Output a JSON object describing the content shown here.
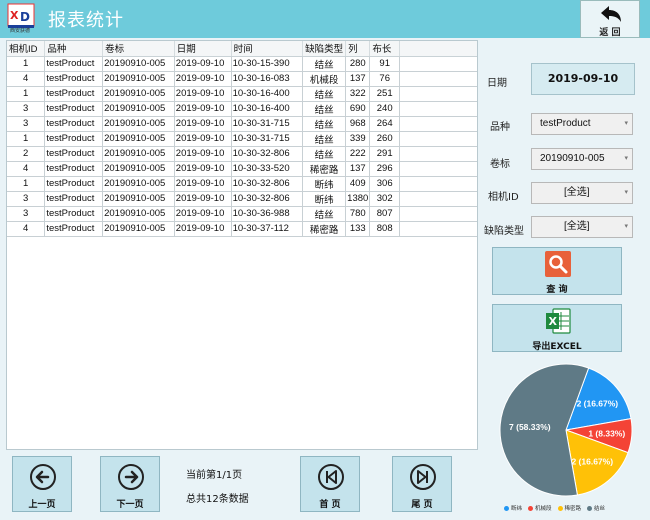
{
  "header": {
    "title": "报表统计",
    "logo_text": "西安获德",
    "back_label": "返 回"
  },
  "table": {
    "columns": [
      "相机ID",
      "品种",
      "卷标",
      "日期",
      "时间",
      "缺陷类型",
      "列",
      "布长"
    ],
    "rows": [
      [
        "1",
        "testProduct",
        "20190910-005",
        "2019-09-10",
        "10-30-15-390",
        "结丝",
        "280",
        "91"
      ],
      [
        "4",
        "testProduct",
        "20190910-005",
        "2019-09-10",
        "10-30-16-083",
        "机械段",
        "137",
        "76"
      ],
      [
        "1",
        "testProduct",
        "20190910-005",
        "2019-09-10",
        "10-30-16-400",
        "结丝",
        "322",
        "251"
      ],
      [
        "3",
        "testProduct",
        "20190910-005",
        "2019-09-10",
        "10-30-16-400",
        "结丝",
        "690",
        "240"
      ],
      [
        "3",
        "testProduct",
        "20190910-005",
        "2019-09-10",
        "10-30-31-715",
        "结丝",
        "968",
        "264"
      ],
      [
        "1",
        "testProduct",
        "20190910-005",
        "2019-09-10",
        "10-30-31-715",
        "结丝",
        "339",
        "260"
      ],
      [
        "2",
        "testProduct",
        "20190910-005",
        "2019-09-10",
        "10-30-32-806",
        "结丝",
        "222",
        "291"
      ],
      [
        "4",
        "testProduct",
        "20190910-005",
        "2019-09-10",
        "10-30-33-520",
        "稀密路",
        "137",
        "296"
      ],
      [
        "1",
        "testProduct",
        "20190910-005",
        "2019-09-10",
        "10-30-32-806",
        "断纬",
        "409",
        "306"
      ],
      [
        "3",
        "testProduct",
        "20190910-005",
        "2019-09-10",
        "10-30-32-806",
        "断纬",
        "1380",
        "302"
      ],
      [
        "3",
        "testProduct",
        "20190910-005",
        "2019-09-10",
        "10-30-36-988",
        "结丝",
        "780",
        "807"
      ],
      [
        "4",
        "testProduct",
        "20190910-005",
        "2019-09-10",
        "10-30-37-112",
        "稀密路",
        "133",
        "808"
      ]
    ]
  },
  "filters": {
    "date_label": "日期",
    "date_value": "2019-09-10",
    "product_label": "品种",
    "product_value": "testProduct",
    "roll_label": "卷标",
    "roll_value": "20190910-005",
    "camera_label": "相机ID",
    "camera_value": "[全选]",
    "defect_label": "缺陷类型",
    "defect_value": "[全选]"
  },
  "buttons": {
    "query": "查 询",
    "export": "导出EXCEL",
    "prev": "上一页",
    "next": "下一页",
    "first": "首 页",
    "last": "尾 页"
  },
  "pagination": {
    "current": "当前第1/1页",
    "total": "总共12条数据"
  },
  "colors": {
    "header": "#6ecbdb",
    "query_icon": "#e8613a",
    "excel_icon": "#1f8a3e"
  },
  "chart_data": {
    "type": "pie",
    "slices": [
      {
        "name": "断纬",
        "value": 2,
        "label": "2 (16.67%)",
        "color": "#2196f3"
      },
      {
        "name": "机械段",
        "value": 1,
        "label": "1 (8.33%)",
        "color": "#f44336"
      },
      {
        "name": "稀密路",
        "value": 2,
        "label": "2 (16.67%)",
        "color": "#ffc107"
      },
      {
        "name": "结丝",
        "value": 7,
        "label": "7 (58.33%)",
        "color": "#5f7a86"
      }
    ],
    "legend_position": "bottom"
  }
}
